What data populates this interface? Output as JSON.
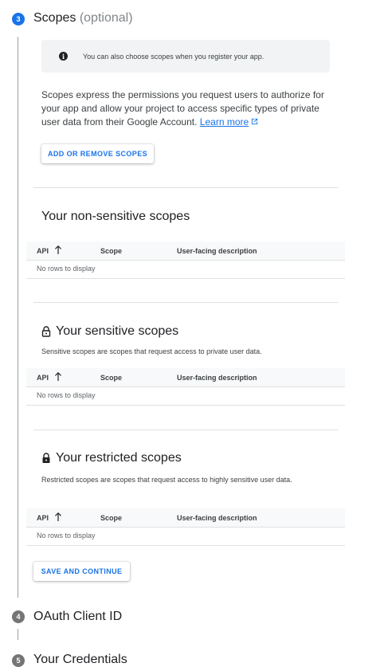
{
  "step3": {
    "number": "3",
    "title": "Scopes",
    "optional": "(optional)",
    "info_text": "You can also choose scopes when you register your app.",
    "description": "Scopes express the permissions you request users to authorize for your app and allow your project to access specific types of private user data from their Google Account.",
    "learn_more": "Learn more",
    "add_button": "ADD OR REMOVE SCOPES",
    "save_button": "SAVE AND CONTINUE"
  },
  "tables": {
    "col_api": "API",
    "col_scope": "Scope",
    "col_description": "User-facing description",
    "empty": "No rows to display"
  },
  "non_sensitive": {
    "title": "Your non-sensitive scopes"
  },
  "sensitive": {
    "title": "Your sensitive scopes",
    "description": "Sensitive scopes are scopes that request access to private user data."
  },
  "restricted": {
    "title": "Your restricted scopes",
    "description": "Restricted scopes are scopes that request access to highly sensitive user data."
  },
  "step4": {
    "number": "4",
    "title": "OAuth Client ID"
  },
  "step5": {
    "number": "5",
    "title": "Your Credentials"
  },
  "colors": {
    "accent": "#1a73e8",
    "inactive_step": "#757575"
  },
  "icons": {
    "info": "info-icon",
    "sort": "arrow-up-icon",
    "unlocked": "lock-open-icon",
    "locked": "lock-icon",
    "external": "open-in-new-icon"
  }
}
